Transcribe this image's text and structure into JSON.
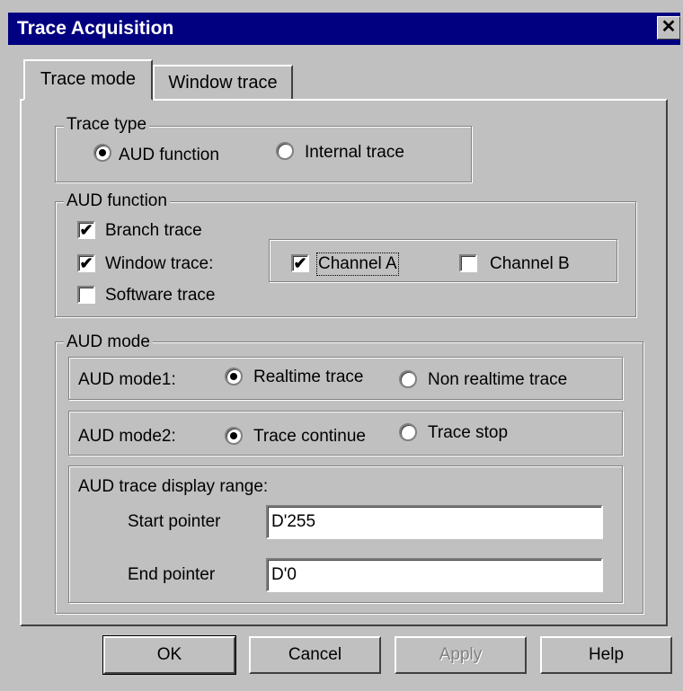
{
  "window": {
    "title": "Trace Acquisition",
    "close_glyph": "✕"
  },
  "tabs": [
    {
      "label": "Trace mode",
      "active": true
    },
    {
      "label": "Window trace",
      "active": false
    }
  ],
  "trace_type": {
    "legend": "Trace type",
    "options": [
      {
        "label": "AUD function",
        "selected": true
      },
      {
        "label": "Internal trace",
        "selected": false
      }
    ]
  },
  "aud_function": {
    "legend": "AUD function",
    "branch_trace": {
      "label": "Branch trace",
      "checked": true
    },
    "window_trace": {
      "label": "Window trace:",
      "checked": true
    },
    "software_trace": {
      "label": "Software trace",
      "checked": false
    },
    "channel_a": {
      "label": "Channel A",
      "checked": true
    },
    "channel_b": {
      "label": "Channel B",
      "checked": false
    },
    "check_glyph": "✔"
  },
  "aud_mode": {
    "legend": "AUD mode",
    "mode1": {
      "label": "AUD mode1:",
      "opt1": "Realtime trace",
      "opt2": "Non realtime trace",
      "selected": 1
    },
    "mode2": {
      "label": "AUD mode2:",
      "opt1": "Trace continue",
      "opt2": "Trace stop",
      "selected": 1
    },
    "range": {
      "label": "AUD trace display range:",
      "start_label": "Start pointer",
      "start_value": "D'255",
      "end_label": "End pointer",
      "end_value": "D'0"
    }
  },
  "buttons": {
    "ok": "OK",
    "cancel": "Cancel",
    "apply": "Apply",
    "help": "Help"
  },
  "colors": {
    "titlebar": "#000080",
    "face": "#c0c0c0"
  }
}
